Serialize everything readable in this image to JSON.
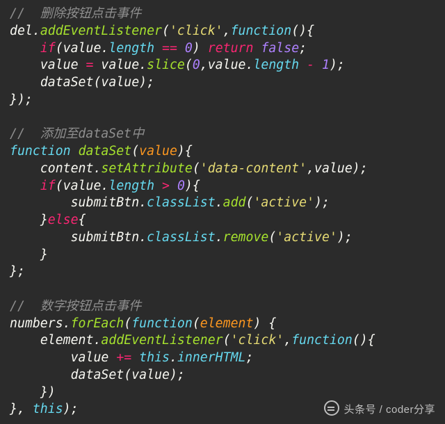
{
  "comments": {
    "c1": "//  删除按钮点击事件",
    "c2": "//  添加至dataSet中",
    "c3": "//  数字按钮点击事件"
  },
  "ids": {
    "del": "del",
    "value": "value",
    "content": "content",
    "submitBtn": "submitBtn",
    "numbers": "numbers",
    "element": "element",
    "dataSet": "dataSet"
  },
  "kw": {
    "if": "if",
    "return": "return",
    "function": "function",
    "else": "else",
    "this": "this"
  },
  "fn": {
    "addEventListener": "addEventListener",
    "slice": "slice",
    "setAttribute": "setAttribute",
    "add": "add",
    "remove": "remove",
    "forEach": "forEach"
  },
  "prop": {
    "length": "length",
    "classList": "classList",
    "innerHTML": "innerHTML"
  },
  "str": {
    "click": "'click'",
    "dataContent": "'data-content'",
    "active": "'active'"
  },
  "num": {
    "zero": "0",
    "one": "1"
  },
  "bool": {
    "false": "false"
  },
  "op": {
    "eqeq": "==",
    "gt": ">",
    "minus": "-",
    "assign": "=",
    "pluseq": "+="
  },
  "watermark": "头条号 / coder分享"
}
